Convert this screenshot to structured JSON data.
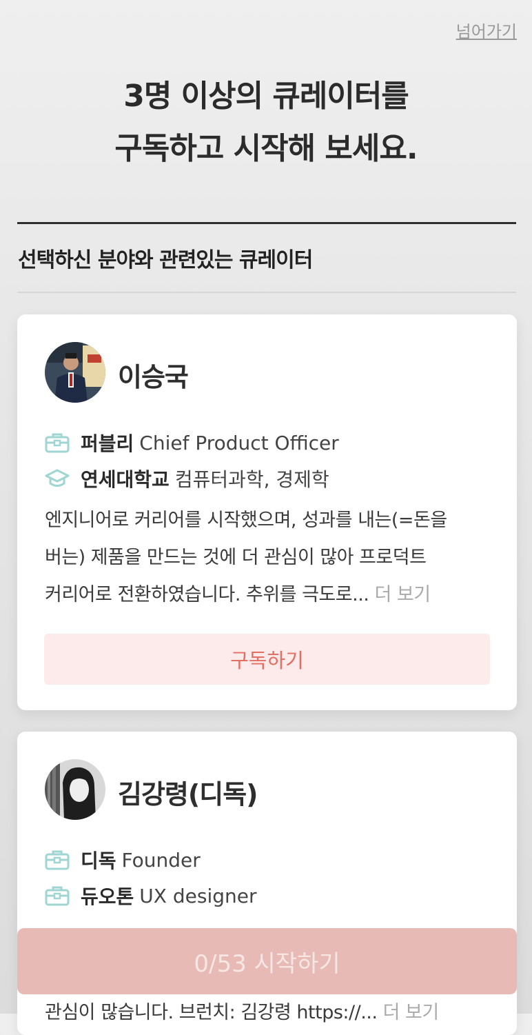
{
  "skip_label": "넘어가기",
  "headline": {
    "line1": "3명 이상의 큐레이터를",
    "line2": "구독하고 시작해 보세요."
  },
  "section_title": "선택하신 분야와 관련있는 큐레이터",
  "curators": [
    {
      "name": "이승국",
      "rows": [
        {
          "icon": "briefcase-icon",
          "org": "퍼블리",
          "role": "Chief Product Officer"
        },
        {
          "icon": "graduation-cap-icon",
          "org": "연세대학교",
          "role": "컴퓨터과학, 경제학"
        }
      ],
      "description_lines": [
        "엔지니어로 커리어를 시작했으며, 성과를 내는(=돈을",
        "버는) 제품을 만드는 것에 더 관심이 많아 프로덕트",
        "커리어로 전환하였습니다. 추위를 극도로..."
      ],
      "more_label": "더 보기",
      "subscribe_label": "구독하기"
    },
    {
      "name": "김강령(디독)",
      "rows": [
        {
          "icon": "briefcase-icon",
          "org": "디독",
          "role": "Founder"
        },
        {
          "icon": "briefcase-icon",
          "org": "듀오톤",
          "role": "UX designer"
        }
      ],
      "description_tail": "관심이 많습니다. 브런치: 김강령 https://...",
      "more_label": "더 보기"
    }
  ],
  "start_button": "0/53 시작하기",
  "colors": {
    "accent_text": "#e36e62",
    "subscribe_bg": "#fcebea",
    "start_bg": "#e8bab5",
    "icon_teal": "#9fd6d3"
  }
}
